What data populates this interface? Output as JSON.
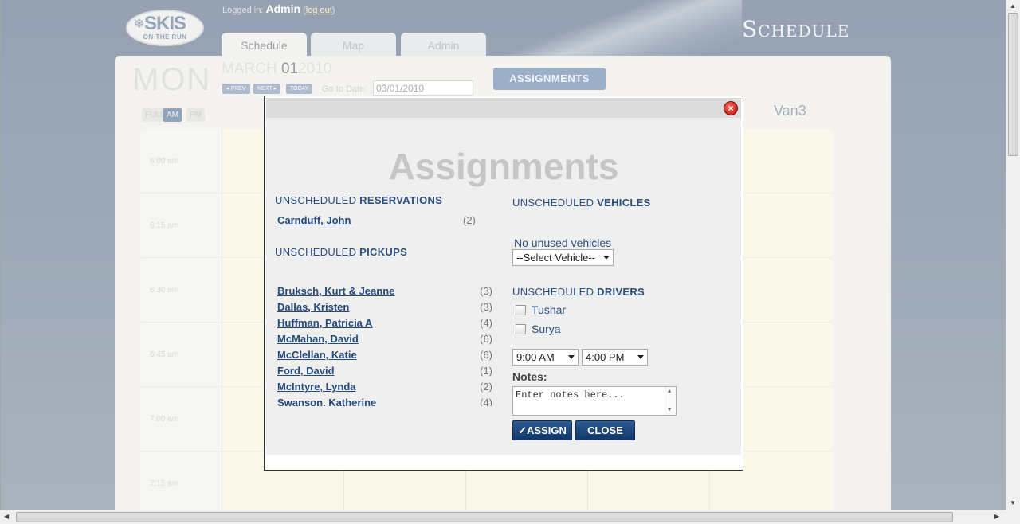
{
  "header": {
    "logo_line1": "SKIS",
    "logo_line2": "ON THE RUN",
    "logged_prefix": "Logged in:",
    "user": "Admin",
    "logout": "log out",
    "page_title": "Schedule"
  },
  "tabs": [
    {
      "label": "Schedule"
    },
    {
      "label": "Map"
    },
    {
      "label": "Admin"
    }
  ],
  "schedule": {
    "weekday": "MON",
    "month": "MARCH",
    "day": "01",
    "year": "2010",
    "prev": "◂ PREV",
    "next": "NEXT ▸",
    "today": "TODAY",
    "goto_label": "Go to Date:",
    "goto_value": "03/01/2010",
    "assignments_button": "ASSIGNMENTS",
    "views": [
      "FULL",
      "AM",
      "PM"
    ],
    "active_view": "AM",
    "column_header": "Van3",
    "times": [
      "6:00 am",
      "6:15 am",
      "6:30 am",
      "6:45 am",
      "7:00 am",
      "7:15 am"
    ]
  },
  "modal": {
    "title": "Assignments",
    "close_icon": "close-icon",
    "reservations_heading_a": "UNSCHEDULED ",
    "reservations_heading_b": "RESERVATIONS",
    "reservations": [
      {
        "name": "Carnduff, John",
        "count": "(2)"
      }
    ],
    "pickups_heading_a": "UNSCHEDULED ",
    "pickups_heading_b": "PICKUPS",
    "pickups": [
      {
        "name": "Bruksch, Kurt & Jeanne",
        "count": "(3)"
      },
      {
        "name": "Dallas, Kristen",
        "count": "(3)"
      },
      {
        "name": "Huffman, Patricia A",
        "count": "(4)"
      },
      {
        "name": "McMahan, David",
        "count": "(6)"
      },
      {
        "name": "McClellan, Katie",
        "count": "(6)"
      },
      {
        "name": "Ford, David",
        "count": "(1)"
      },
      {
        "name": "McIntyre, Lynda",
        "count": "(2)"
      },
      {
        "name": "Swanson, Katherine",
        "count": "(4)"
      }
    ],
    "vehicles_heading_a": "UNSCHEDULED ",
    "vehicles_heading_b": "VEHICLES",
    "vehicles_empty": "No unused vehicles",
    "vehicle_select": "--Select Vehicle--",
    "drivers_heading_a": "UNSCHEDULED ",
    "drivers_heading_b": "DRIVERS",
    "drivers": [
      {
        "name": "Tushar",
        "checked": false
      },
      {
        "name": "Surya",
        "checked": false
      }
    ],
    "start_time": "9:00 AM",
    "end_time": "4:00 PM",
    "notes_label": "Notes:",
    "notes_placeholder": "Enter notes here...",
    "assign_label": "ASSIGN",
    "close_label": "CLOSE"
  }
}
